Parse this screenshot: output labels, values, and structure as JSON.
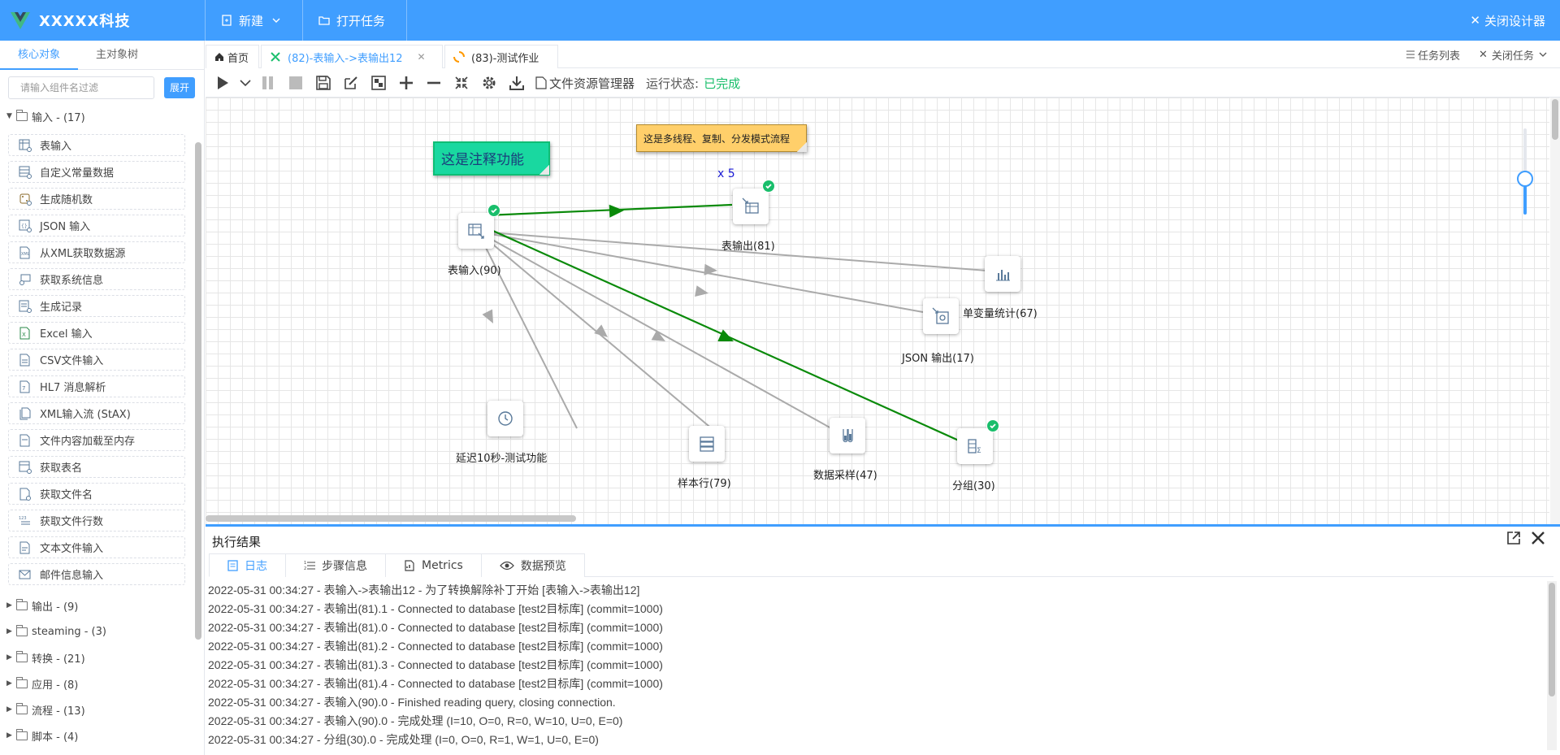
{
  "brand": {
    "name": "XXXXX科技"
  },
  "top_menu": {
    "new_label": "新建",
    "open_label": "打开任务",
    "close_designer": "关闭设计器"
  },
  "sidebar": {
    "tabs": [
      "核心对象",
      "主对象树"
    ],
    "search_placeholder": "请输入组件名过滤",
    "expand_label": "展开",
    "input_group": "输入 - (17)",
    "items": [
      "表输入",
      "自定义常量数据",
      "生成随机数",
      "JSON 输入",
      "从XML获取数据源",
      "获取系统信息",
      "生成记录",
      "Excel 输入",
      "CSV文件输入",
      "HL7 消息解析",
      "XML输入流 (StAX)",
      "文件内容加载至内存",
      "获取表名",
      "获取文件名",
      "获取文件行数",
      "文本文件输入",
      "邮件信息输入"
    ],
    "groups": [
      "输出 - (9)",
      "steaming - (3)",
      "转换 - (21)",
      "应用 - (8)",
      "流程 - (13)",
      "脚本 - (4)"
    ]
  },
  "tabs": {
    "home": "首页",
    "tab1": "(82)-表输入->表输出12",
    "tab2": "(83)-测试作业",
    "task_list": "任务列表",
    "close_task": "关闭任务"
  },
  "toolbar": {
    "file_manager": "文件资源管理器",
    "run_status_label": "运行状态:",
    "run_status_value": "已完成"
  },
  "canvas": {
    "note_green": "这是注释功能",
    "note_yellow": "这是多线程、复制、分发模式流程",
    "copies": "x 5",
    "nodes": {
      "table_input": "表输入(90)",
      "table_output": "表输出(81)",
      "stats": "单变量统计(67)",
      "json_output": "JSON 输出(17)",
      "delay": "延迟10秒-测试功能",
      "sample_rows": "样本行(79)",
      "sampling": "数据采样(47)",
      "group": "分组(30)"
    }
  },
  "bottom": {
    "title": "执行结果",
    "tabs": [
      "日志",
      "步骤信息",
      "Metrics",
      "数据预览"
    ],
    "logs": [
      "2022-05-31 00:34:27 - 表输入->表输出12 - 为了转换解除补丁开始 [表输入->表输出12]",
      "2022-05-31 00:34:27 - 表输出(81).1 - Connected to database [test2目标库] (commit=1000)",
      "2022-05-31 00:34:27 - 表输出(81).0 - Connected to database [test2目标库] (commit=1000)",
      "2022-05-31 00:34:27 - 表输出(81).2 - Connected to database [test2目标库] (commit=1000)",
      "2022-05-31 00:34:27 - 表输出(81).3 - Connected to database [test2目标库] (commit=1000)",
      "2022-05-31 00:34:27 - 表输出(81).4 - Connected to database [test2目标库] (commit=1000)",
      "2022-05-31 00:34:27 - 表输入(90).0 - Finished reading query, closing connection.",
      "2022-05-31 00:34:27 - 表输入(90).0 - 完成处理 (I=10, O=0, R=0, W=10, U=0, E=0)",
      "2022-05-31 00:34:27 - 分组(30).0 - 完成处理 (I=0, O=0, R=1, W=1, U=0, E=0)"
    ]
  },
  "colors": {
    "primary": "#409eff",
    "success": "#19be6b",
    "hop_green": "#0a8a0a",
    "hop_gray": "#aaaaaa"
  }
}
